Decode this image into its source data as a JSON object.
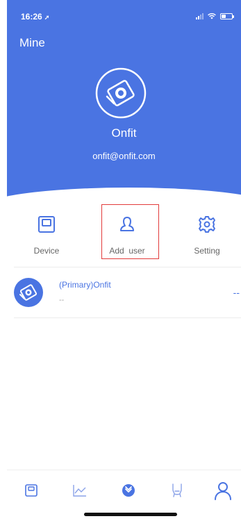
{
  "status_bar": {
    "time": "16:26",
    "location_glyph": "➚"
  },
  "page": {
    "title": "Mine"
  },
  "profile": {
    "name": "Onfit",
    "email": "onfit@onfit.com"
  },
  "actions": [
    {
      "label": "Device",
      "icon": "device-icon"
    },
    {
      "label": "Add  user",
      "icon": "add-user-icon"
    },
    {
      "label": "Setting",
      "icon": "gear-icon"
    }
  ],
  "user_list": [
    {
      "name": "(Primary)Onfit",
      "sub": "--",
      "value": "--"
    }
  ],
  "tabbar": [
    {
      "icon": "scale-icon"
    },
    {
      "icon": "chart-icon"
    },
    {
      "icon": "onfit-logo-icon"
    },
    {
      "icon": "body-icon"
    },
    {
      "icon": "person-icon"
    }
  ],
  "colors": {
    "accent": "#4a74e2",
    "highlight": "#e23b3b"
  }
}
